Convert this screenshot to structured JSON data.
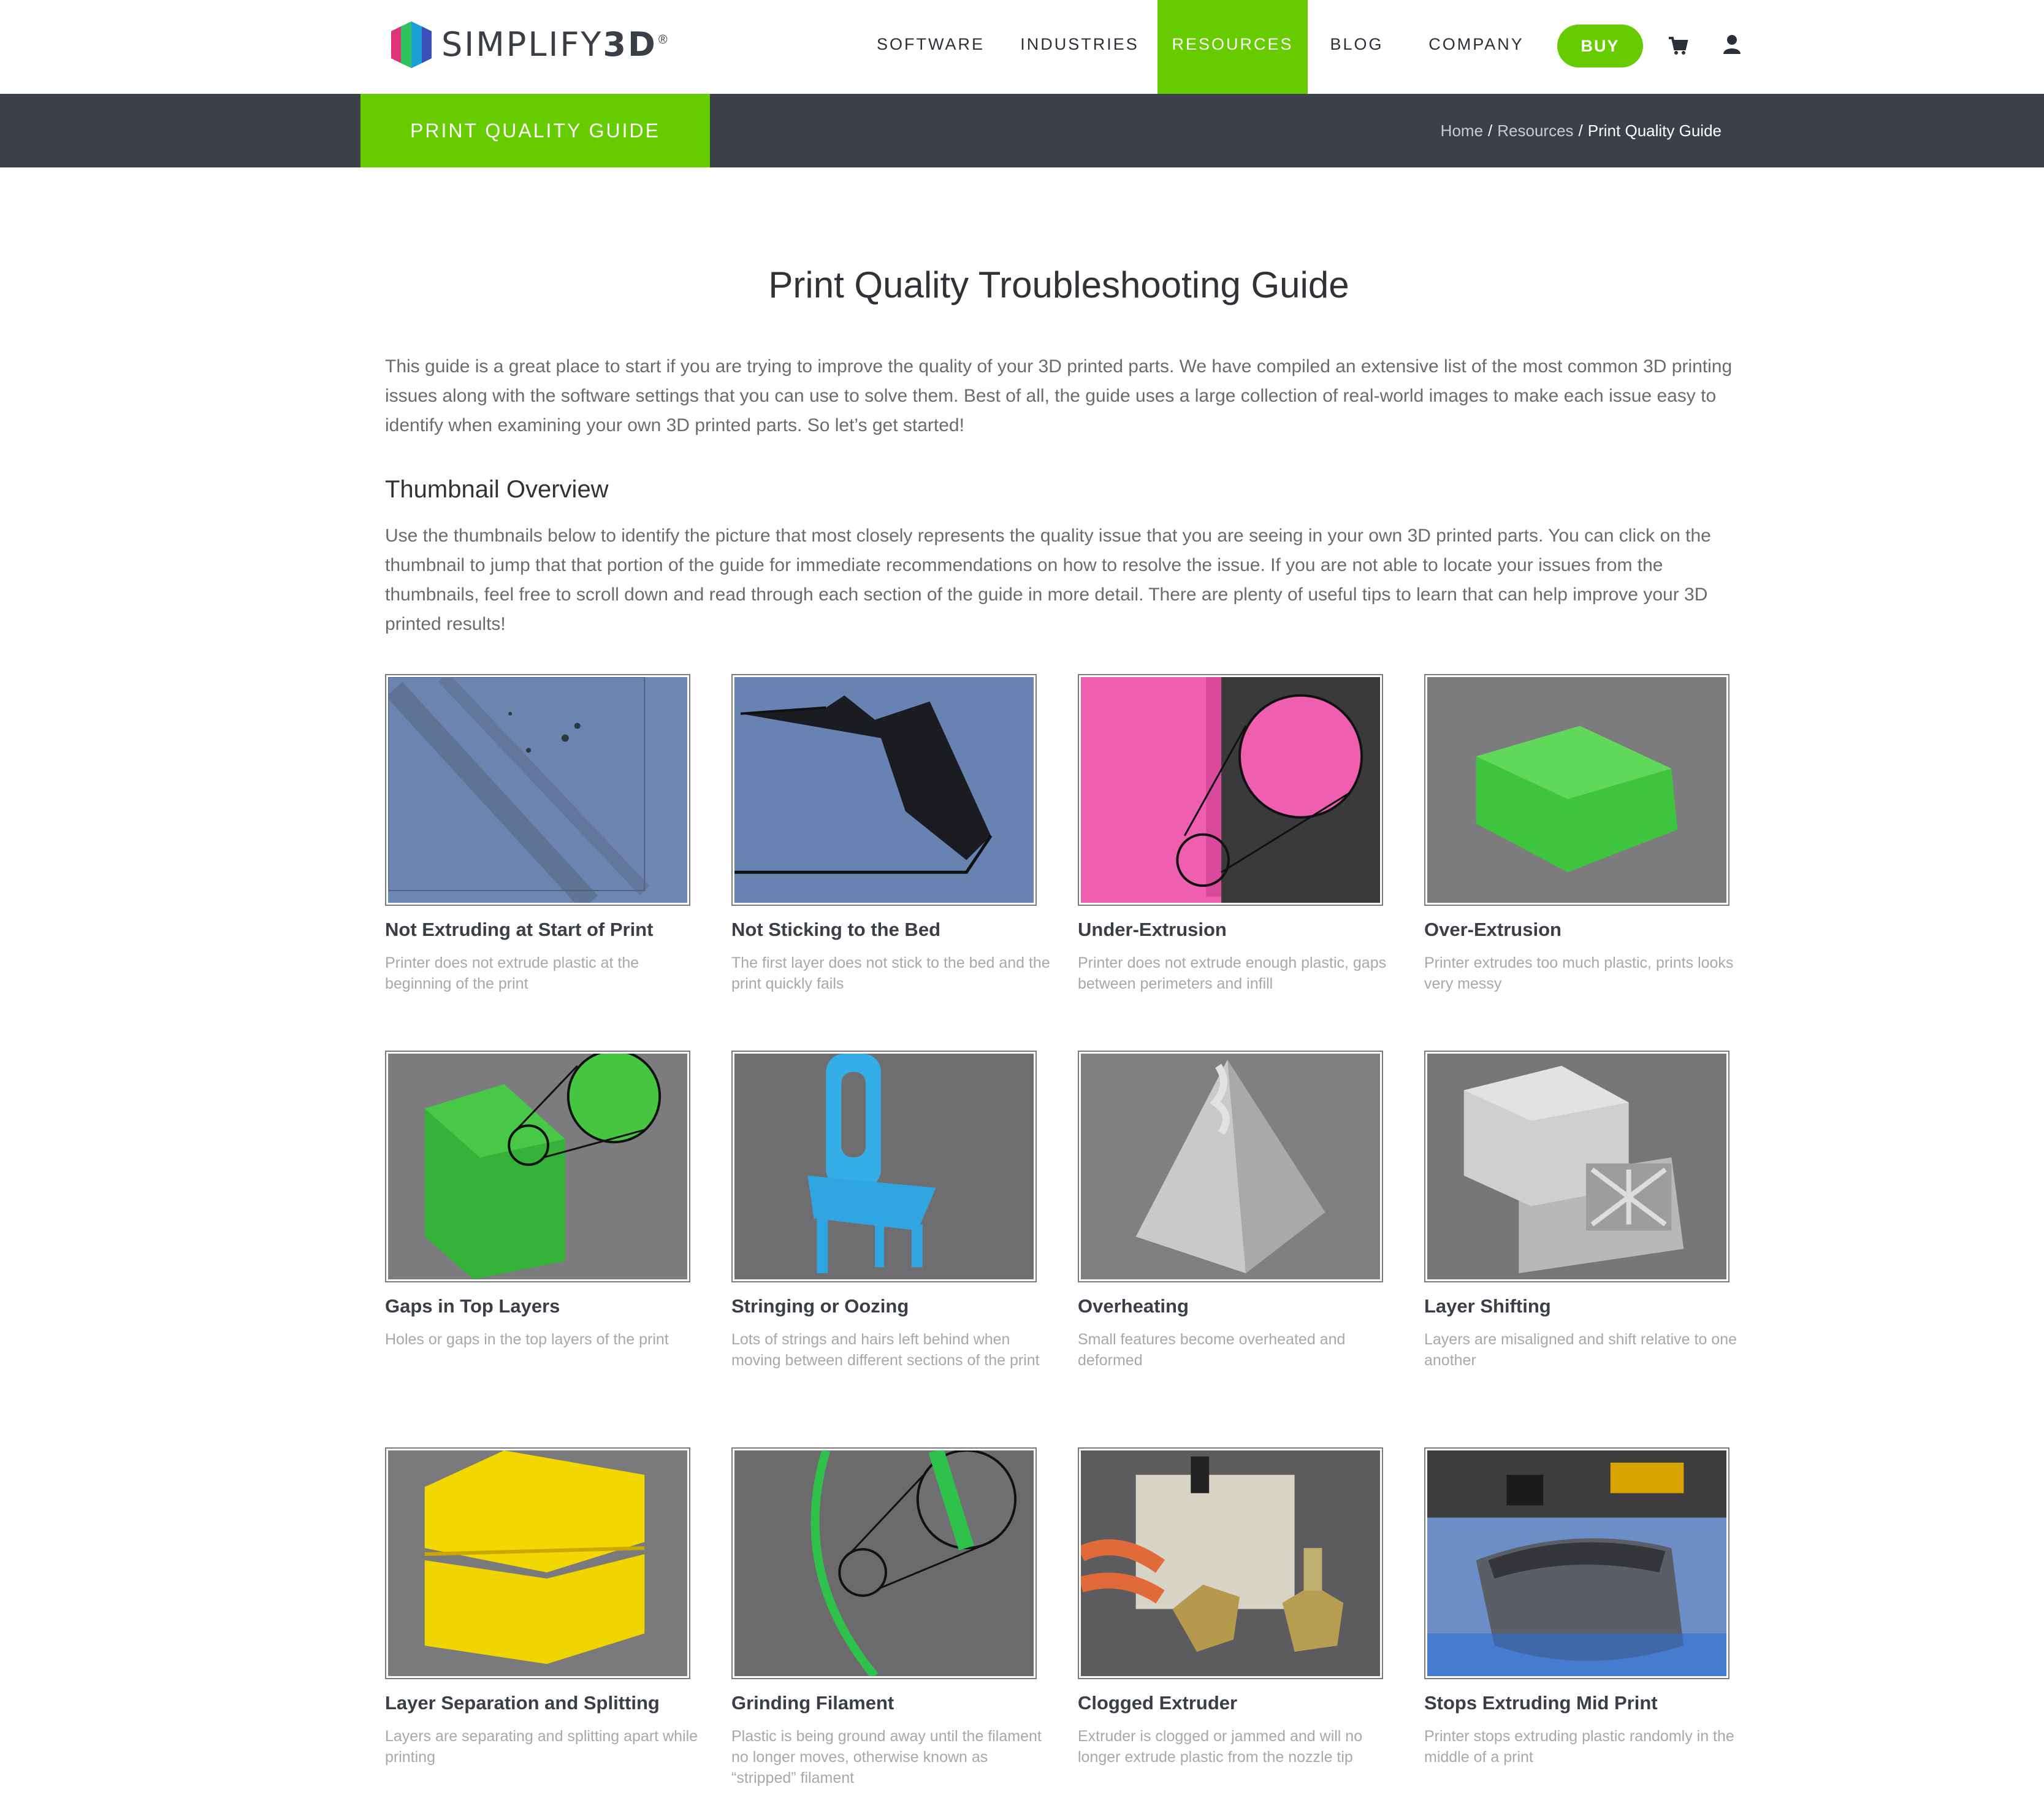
{
  "header": {
    "logo_text_light": "SIMPLIFY",
    "logo_text_bold": "3D",
    "logo_registered": "®",
    "nav": [
      {
        "label": "SOFTWARE",
        "active": false
      },
      {
        "label": "INDUSTRIES",
        "active": false
      },
      {
        "label": "RESOURCES",
        "active": true
      },
      {
        "label": "BLOG",
        "active": false
      },
      {
        "label": "COMPANY",
        "active": false
      }
    ],
    "buy_label": "BUY",
    "cart_icon": "shopping-cart-icon",
    "account_icon": "user-icon"
  },
  "titlebar": {
    "section_label": "PRINT QUALITY GUIDE",
    "breadcrumb": {
      "home": "Home",
      "resources": "Resources",
      "current": "Print Quality Guide",
      "separator": "/"
    }
  },
  "main": {
    "title": "Print Quality Troubleshooting Guide",
    "intro": "This guide is a great place to start if you are trying to improve the quality of your 3D printed parts. We have compiled an extensive list of the most common 3D printing issues along with the software settings that you can use to solve them. Best of all, the guide uses a large collection of real-world images to make each issue easy to identify when examining your own 3D printed parts. So let’s get started!",
    "overview_heading": "Thumbnail Overview",
    "overview_text": "Use the thumbnails below to identify the picture that most closely represents the quality issue that you are seeing in your own 3D printed parts. You can click on the thumbnail to jump that that portion of the guide for immediate recommendations on how to resolve the issue. If you are not able to locate your issues from the thumbnails, feel free to scroll down and read through each section of the guide in more detail. There are plenty of useful tips to learn that can help improve your 3D printed results!",
    "cards": [
      {
        "title": "Not Extruding at Start of Print",
        "desc": "Printer does not extrude plastic at the beginning of the print"
      },
      {
        "title": "Not Sticking to the Bed",
        "desc": "The first layer does not stick to the bed and the print quickly fails"
      },
      {
        "title": "Under-Extrusion",
        "desc": "Printer does not extrude enough plastic, gaps between perimeters and infill"
      },
      {
        "title": "Over-Extrusion",
        "desc": "Printer extrudes too much plastic, prints looks very messy"
      },
      {
        "title": "Gaps in Top Layers",
        "desc": "Holes or gaps in the top layers of the print"
      },
      {
        "title": "Stringing or Oozing",
        "desc": "Lots of strings and hairs left behind when moving between different sections of the print"
      },
      {
        "title": "Overheating",
        "desc": "Small features become overheated and deformed"
      },
      {
        "title": "Layer Shifting",
        "desc": "Layers are misaligned and shift relative to one another"
      },
      {
        "title": "Layer Separation and Splitting",
        "desc": "Layers are separating and splitting apart while printing"
      },
      {
        "title": "Grinding Filament",
        "desc": "Plastic is being ground away until the filament no longer moves, otherwise known as “stripped” filament"
      },
      {
        "title": "Clogged Extruder",
        "desc": "Extruder is clogged or jammed and will no longer extrude plastic from the nozzle tip"
      },
      {
        "title": "Stops Extruding Mid Print",
        "desc": "Printer stops extruding plastic randomly in the middle of a print"
      }
    ]
  },
  "colors": {
    "brand_green": "#66cc00",
    "titlebar_bg": "#3b4049"
  }
}
